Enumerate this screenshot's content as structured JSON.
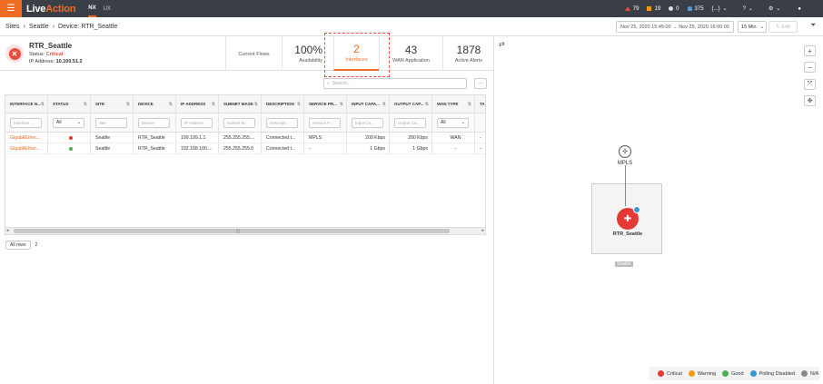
{
  "topbar": {
    "logo_part1": "Live",
    "logo_part2": "Action",
    "tabs": [
      "NX",
      "UX"
    ],
    "alerts": {
      "critical": "79",
      "warning": "19",
      "info": "0",
      "users": "375"
    },
    "bracket": "{...}"
  },
  "breadcrumb": {
    "items": [
      "Sites",
      "Seattle",
      "Device: RTR_Seattle"
    ]
  },
  "timerange": {
    "value": "Nov 25, 2020 15:45:00 → Nov 25, 2020 16:00:00",
    "interval": "15 Min",
    "edit_label": "Edit"
  },
  "device": {
    "name": "RTR_Seattle",
    "status_label": "Status:",
    "status": "Critical",
    "ip_label": "IP Address:",
    "ip": "10.100.51.2"
  },
  "stats": [
    {
      "value": "",
      "label": "Current Flows"
    },
    {
      "value": "100%",
      "label": "Availability"
    },
    {
      "value": "2",
      "label": "Interfaces"
    },
    {
      "value": "43",
      "label": "WAN Application"
    },
    {
      "value": "1878",
      "label": "Active Alerts"
    }
  ],
  "search": {
    "placeholder": "Search..."
  },
  "table": {
    "headers": [
      "INTERFACE N...",
      "STATUS",
      "SITE",
      "DEVICE",
      "IP ADDRESS",
      "SUBNET MASK",
      "DESCRIPTION",
      "SERVICE PR...",
      "INPUT CAPA...",
      "OUTPUT CAP...",
      "WAN TYPE",
      "TA"
    ],
    "filters": [
      "Interface ...",
      "All",
      "Site",
      "Device",
      "IP Address",
      "Subnet M...",
      "Descripti...",
      "Service P...",
      "Input Ca...",
      "Output Ca...",
      "All",
      ""
    ],
    "rows": [
      [
        "GigabitEther...",
        "critical",
        "Seattle",
        "RTR_Seattle",
        "199.199.1.1",
        "255.255.255....",
        "Connected t...",
        "MPLS",
        "200 Kbps",
        "200 Kbps",
        "WAN",
        "-"
      ],
      [
        "GigabitEther...",
        "good",
        "Seattle",
        "RTR_Seattle",
        "192.168.100....",
        "255.255.255.0",
        "Connected t...",
        "-",
        "1 Gbps",
        "1 Gbps",
        "-",
        "-"
      ]
    ]
  },
  "pager": {
    "rows_label": "All rows",
    "count": "2"
  },
  "topology": {
    "cloud_label": "MPLS",
    "node_label": "RTR_Seattle",
    "site_label": "Seattle"
  },
  "legend": [
    {
      "label": "Critical",
      "color": "#e53935"
    },
    {
      "label": "Warning",
      "color": "#f39c12"
    },
    {
      "label": "Good",
      "color": "#4caf50"
    },
    {
      "label": "Polling Disabled",
      "color": "#3498db"
    },
    {
      "label": "N/A",
      "color": "#888888"
    }
  ],
  "colors": {
    "accent": "#f06c23",
    "critical": "#e53935",
    "good": "#4caf50"
  }
}
